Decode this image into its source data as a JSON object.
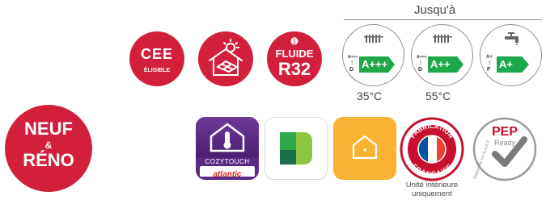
{
  "colors": {
    "brand_red": "#d2203c",
    "energy_green": "#1fa84a",
    "atlantic_purple": "#5b2a86",
    "app_orange": "#f9b233",
    "grey_line": "#8a8a8a"
  },
  "header": {
    "up_to": "Jusqu'à"
  },
  "badges": {
    "cee": {
      "main": "CEE",
      "sub": "ÉLIGIBLE"
    },
    "solar": {
      "icon": "solar-house-icon"
    },
    "fluide": {
      "line1": "FLUIDE",
      "line2": "R32"
    },
    "neuf": {
      "line1": "NEUF",
      "amp": "&",
      "line2": "RÉNO"
    }
  },
  "energy": [
    {
      "icon": "radiator-icon",
      "rating": "A+++",
      "scale_top": "A+++",
      "scale_bottom": "D",
      "temp": "35°C"
    },
    {
      "icon": "radiator-icon",
      "rating": "A++",
      "scale_top": "A+++",
      "scale_bottom": "D",
      "temp": "55°C"
    },
    {
      "icon": "faucet-icon",
      "rating": "A+",
      "scale_top": "A+",
      "scale_bottom": "F",
      "temp": ""
    }
  ],
  "apps": {
    "cozytouch": {
      "name": "COZYTOUCH",
      "brand": "atlantic"
    },
    "fabrication": {
      "top": "FABRICATION",
      "bottom": "FRANÇAISE",
      "note1": "Unité intérieure",
      "note2": "uniquement"
    },
    "pep": {
      "title": "PEP",
      "ready": "Ready",
      "side": "Disponible sur B.A.R.T"
    }
  }
}
